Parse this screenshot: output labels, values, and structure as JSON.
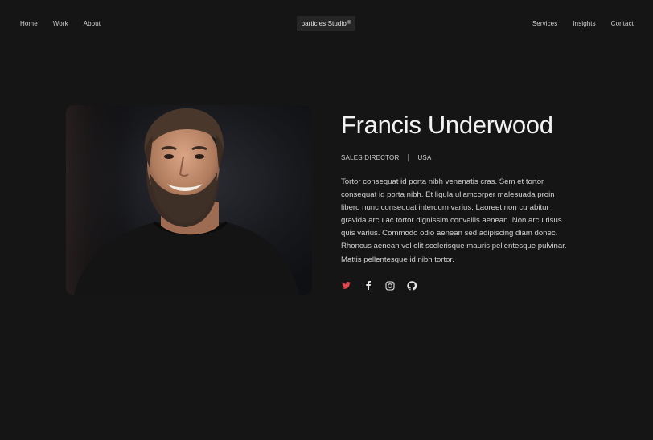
{
  "nav": {
    "left": [
      {
        "label": "Home"
      },
      {
        "label": "Work"
      },
      {
        "label": "About"
      }
    ],
    "right": [
      {
        "label": "Services"
      },
      {
        "label": "Insights"
      },
      {
        "label": "Contact"
      }
    ],
    "logo": {
      "text": "particles Studio",
      "mark": "®"
    }
  },
  "profile": {
    "name": "Francis Underwood",
    "role": "SALES DIRECTOR",
    "location": "USA",
    "bio": "Tortor consequat id porta nibh venenatis cras. Sem et tortor consequat id porta nibh. Et ligula ullamcorper malesuada proin libero nunc consequat interdum varius. Laoreet non curabitur gravida arcu ac tortor dignissim convallis aenean. Non arcu risus quis varius. Commodo odio aenean sed adipiscing diam donec. Rhoncus aenean vel elit scelerisque mauris pellentesque pulvinar. Mattis pellentesque id nibh tortor."
  },
  "socials": [
    {
      "icon": "twitter-icon",
      "color": "#e0474c"
    },
    {
      "icon": "facebook-icon",
      "color": "#e6e6e6"
    },
    {
      "icon": "instagram-icon",
      "color": "#e6e6e6"
    },
    {
      "icon": "github-icon",
      "color": "#e6e6e6"
    }
  ],
  "colors": {
    "background": "#151515",
    "accent": "#e0474c",
    "text": "#f2f2f2"
  }
}
